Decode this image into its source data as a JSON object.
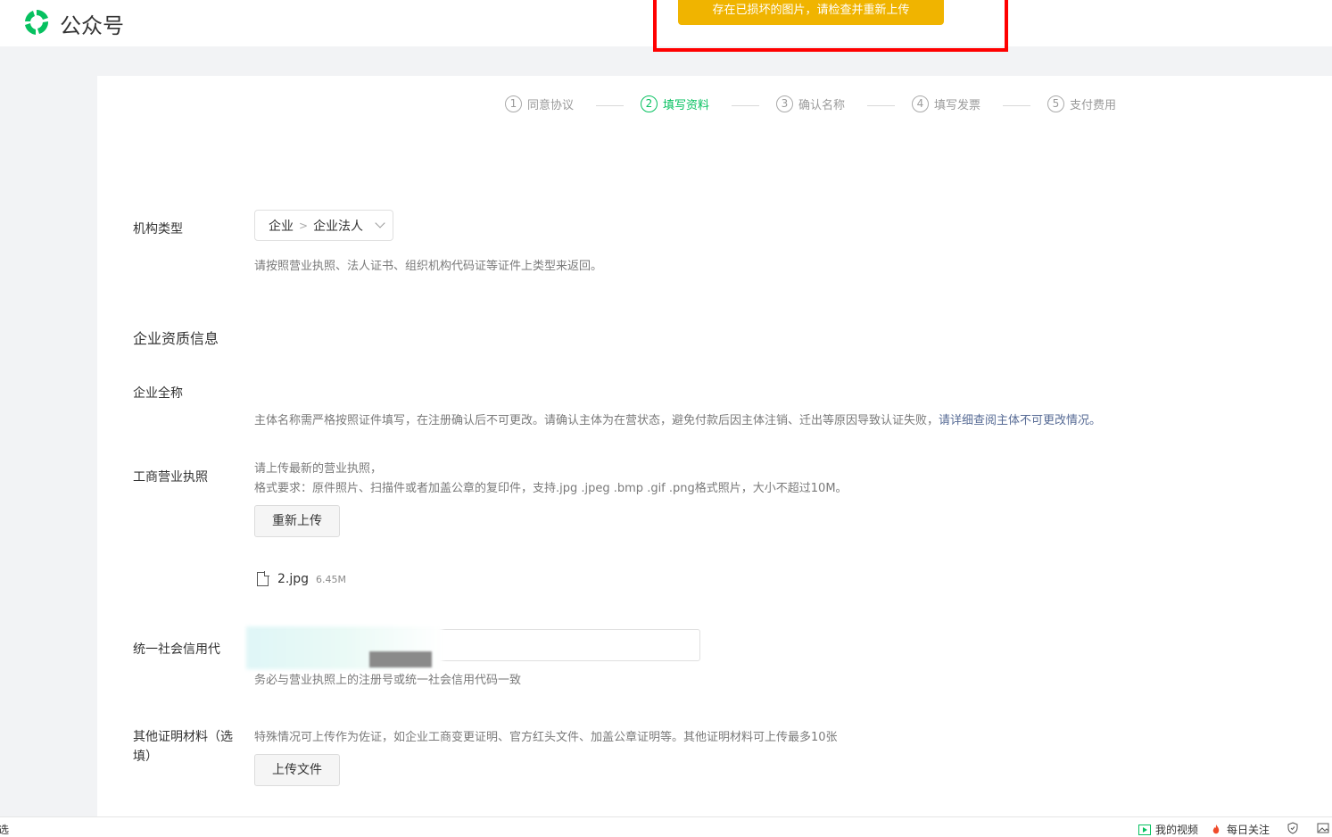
{
  "header": {
    "brand": "公众号",
    "toast": "存在已损坏的图片，请检查并重新上传"
  },
  "steps": [
    {
      "num": "1",
      "label": "同意协议",
      "active": false
    },
    {
      "num": "2",
      "label": "填写资料",
      "active": true
    },
    {
      "num": "3",
      "label": "确认名称",
      "active": false
    },
    {
      "num": "4",
      "label": "填写发票",
      "active": false
    },
    {
      "num": "5",
      "label": "支付费用",
      "active": false
    }
  ],
  "form": {
    "org_type": {
      "label": "机构类型",
      "value_primary": "企业",
      "value_secondary": "企业法人",
      "hint": "请按照营业执照、法人证书、组织机构代码证等证件上类型来返回。"
    },
    "section_title": "企业资质信息",
    "full_name": {
      "label": "企业全称",
      "hint": "主体名称需严格按照证件填写，在注册确认后不可更改。请确认主体为在营状态，避免付款后因主体注销、迁出等原因导致认证失败，",
      "hint_link": "请详细查阅主体不可更改情况。"
    },
    "license": {
      "label": "工商营业执照",
      "hint_line1": "请上传最新的营业执照，",
      "hint_line2": "格式要求：原件照片、扫描件或者加盖公章的复印件，支持.jpg .jpeg .bmp .gif .png格式照片，大小不超过10M。",
      "reupload_label": "重新上传",
      "file_name": "2.jpg",
      "file_size": "6.45M"
    },
    "credit_code": {
      "label": "统一社会信用代",
      "value": "",
      "hint": "务必与营业执照上的注册号或统一社会信用代码一致"
    },
    "other_materials": {
      "label": "其他证明材料（选填）",
      "hint": "特殊情况可上传作为佐证，如企业工商变更证明、官方红头文件、加盖公章证明等。其他证明材料可上传最多10张",
      "upload_label": "上传文件"
    }
  },
  "statusbar": {
    "left_text": "选",
    "my_videos": "我的视频",
    "daily_focus": "每日关注"
  },
  "colors": {
    "brand_green": "#07c160",
    "toast_bg": "#f0b400",
    "highlight_red": "#ff0000",
    "link_blue": "#576b95"
  }
}
